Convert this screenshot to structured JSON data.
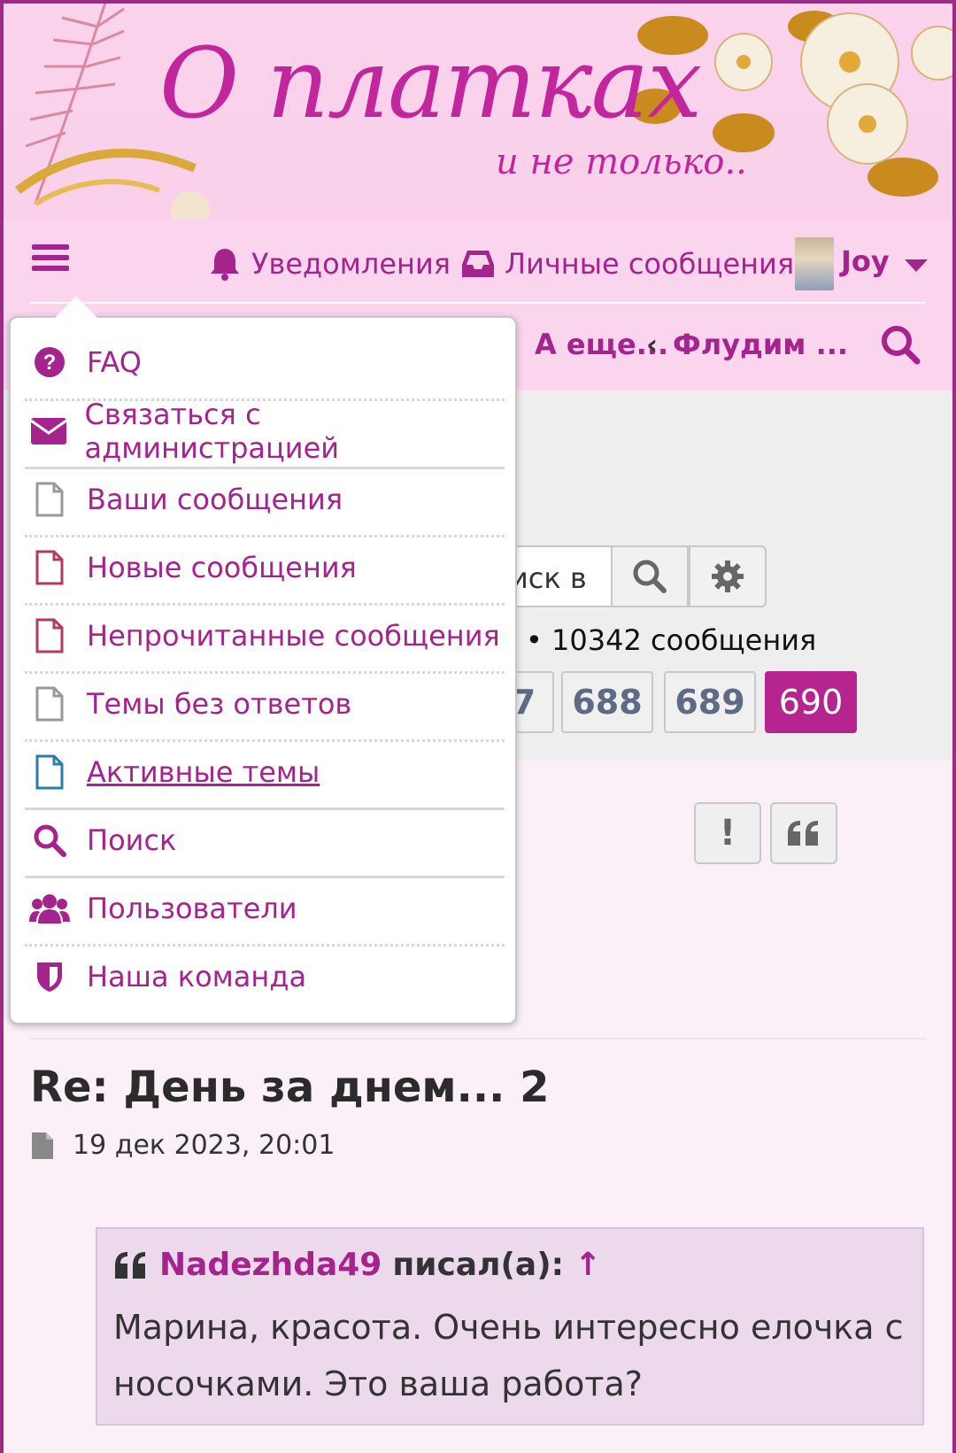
{
  "banner": {
    "title": "О платках",
    "subtitle": "и не только.."
  },
  "nav": {
    "notifications_label": "Уведомления",
    "messages_label": "Личные сообщения",
    "username": "Joy",
    "breadcrumbs": [
      "А еще...",
      "Флудим ..."
    ]
  },
  "menu": {
    "items": [
      {
        "label": "FAQ",
        "icon": "question-circle-icon"
      },
      {
        "label": "Связаться с администрацией",
        "icon": "envelope-icon"
      },
      {
        "label": "Ваши сообщения",
        "icon": "file-icon"
      },
      {
        "label": "Новые сообщения",
        "icon": "file-icon"
      },
      {
        "label": "Непрочитанные сообщения",
        "icon": "file-icon"
      },
      {
        "label": "Темы без ответов",
        "icon": "file-icon"
      },
      {
        "label": "Активные темы",
        "icon": "file-icon"
      },
      {
        "label": "Поиск",
        "icon": "search-icon"
      },
      {
        "label": "Пользователи",
        "icon": "users-icon"
      },
      {
        "label": "Наша команда",
        "icon": "shield-icon"
      }
    ]
  },
  "topic": {
    "search_placeholder": "иск в",
    "stats": "•  10342 сообщения",
    "pages": [
      "7",
      "688",
      "689",
      "690"
    ],
    "active_page": "690"
  },
  "post": {
    "title": "Re: День за днем... 2",
    "date": "19 дек 2023, 20:01",
    "quote": {
      "author": "Nadezhda49",
      "wrote": "писал(а):",
      "arrow": "↑",
      "text": "Марина, красота. Очень интересно елочка с носочками. Это ваша работа?"
    }
  },
  "colors": {
    "accent": "#a5238c",
    "active_page_bg": "#b5248f",
    "banner_bg": "#fbd3ec"
  }
}
